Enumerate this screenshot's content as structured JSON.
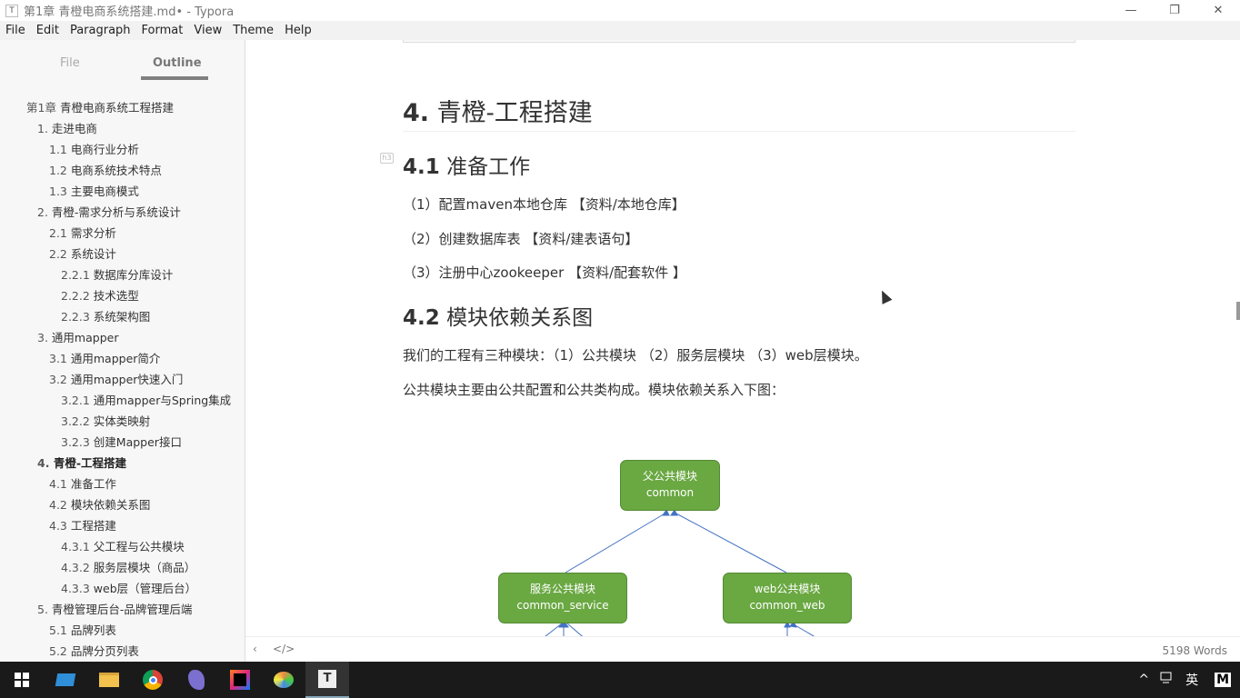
{
  "window": {
    "title": "第1章 青橙电商系统搭建.md• - Typora",
    "app_icon": "T",
    "minimize": "—",
    "restore": "❐",
    "close": "✕"
  },
  "menu": [
    "File",
    "Edit",
    "Paragraph",
    "Format",
    "View",
    "Theme",
    "Help"
  ],
  "sidebar": {
    "tabs": [
      "File",
      "Outline"
    ],
    "active_tab": "Outline",
    "outline": [
      {
        "num": "第1章",
        "text": "青橙电商系统工程搭建",
        "level": 1
      },
      {
        "num": "1.",
        "text": "走进电商",
        "level": 2
      },
      {
        "num": "1.1",
        "text": "电商行业分析",
        "level": 3
      },
      {
        "num": "1.2",
        "text": "电商系统技术特点",
        "level": 3
      },
      {
        "num": "1.3",
        "text": "主要电商模式",
        "level": 3
      },
      {
        "num": "2.",
        "text": "青橙-需求分析与系统设计",
        "level": 2
      },
      {
        "num": "2.1",
        "text": "需求分析",
        "level": 3
      },
      {
        "num": "2.2",
        "text": "系统设计",
        "level": 3
      },
      {
        "num": "2.2.1",
        "text": "数据库分库设计",
        "level": 4
      },
      {
        "num": "2.2.2",
        "text": "技术选型",
        "level": 4
      },
      {
        "num": "2.2.3",
        "text": "系统架构图",
        "level": 4
      },
      {
        "num": "3.",
        "text": "通用mapper",
        "level": 2
      },
      {
        "num": "3.1",
        "text": "通用mapper简介",
        "level": 3
      },
      {
        "num": "3.2",
        "text": "通用mapper快速入门",
        "level": 3
      },
      {
        "num": "3.2.1",
        "text": "通用mapper与Spring集成",
        "level": 4
      },
      {
        "num": "3.2.2",
        "text": "实体类映射",
        "level": 4
      },
      {
        "num": "3.2.3",
        "text": "创建Mapper接口",
        "level": 4
      },
      {
        "num": "4.",
        "text": "青橙-工程搭建",
        "level": 2,
        "active": true
      },
      {
        "num": "4.1",
        "text": "准备工作",
        "level": 3
      },
      {
        "num": "4.2",
        "text": "模块依赖关系图",
        "level": 3
      },
      {
        "num": "4.3",
        "text": "工程搭建",
        "level": 3
      },
      {
        "num": "4.3.1",
        "text": "父工程与公共模块",
        "level": 4
      },
      {
        "num": "4.3.2",
        "text": "服务层模块（商品）",
        "level": 4
      },
      {
        "num": "4.3.3",
        "text": "web层（管理后台）",
        "level": 4
      },
      {
        "num": "5.",
        "text": "青橙管理后台-品牌管理后端",
        "level": 2
      },
      {
        "num": "5.1",
        "text": "品牌列表",
        "level": 3
      },
      {
        "num": "5.2",
        "text": "品牌分页列表",
        "level": 3
      }
    ]
  },
  "document": {
    "h2": {
      "num": "4.",
      "text": "青橙-工程搭建"
    },
    "h3_tag": "h3",
    "s41": {
      "num": "4.1",
      "text": "准备工作",
      "items": [
        "（1）配置maven本地仓库 【资料/本地仓库】",
        "（2）创建数据库表 【资料/建表语句】",
        "（3）注册中心zookeeper 【资料/配套软件 】"
      ]
    },
    "s42": {
      "num": "4.2",
      "text": "模块依赖关系图",
      "paragraphs": [
        "我们的工程有三种模块：（1）公共模块 （2）服务层模块 （3）web层模块。",
        "公共模块主要由公共配置和公共类构成。模块依赖关系入下图："
      ]
    },
    "diagram": {
      "nodes": [
        {
          "title": "父公共模块",
          "sub": "common"
        },
        {
          "title": "服务公共模块",
          "sub": "common_service"
        },
        {
          "title": "web公共模块",
          "sub": "common_web"
        }
      ],
      "node_color": "#6aa842",
      "edge_color": "#4472c4"
    }
  },
  "footer": {
    "back": "‹",
    "source": "</>",
    "words": "5198 Words"
  },
  "taskbar": {
    "tray": {
      "chevron": "^",
      "ime": "英",
      "app": "M"
    }
  }
}
